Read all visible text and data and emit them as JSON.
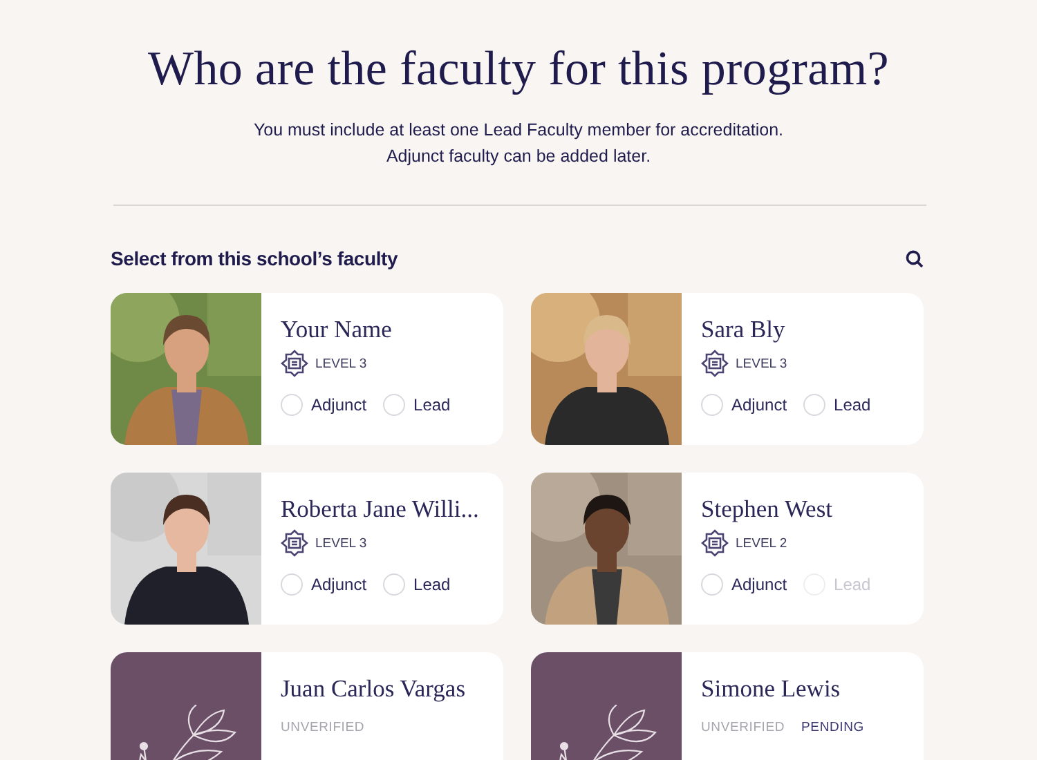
{
  "header": {
    "title": "Who are the faculty for this program?",
    "subtitle_lines": [
      "You must include at least one Lead Faculty member for accreditation.",
      "Adjunct faculty can be added later."
    ]
  },
  "section": {
    "title": "Select from this school’s faculty"
  },
  "faculty": [
    {
      "name": "Your Name",
      "level": "LEVEL 3",
      "options": [
        {
          "label": "Adjunct",
          "selected": false,
          "disabled": false
        },
        {
          "label": "Lead",
          "selected": false,
          "disabled": false
        }
      ]
    },
    {
      "name": "Sara Bly",
      "level": "LEVEL 3",
      "options": [
        {
          "label": "Adjunct",
          "selected": false,
          "disabled": false
        },
        {
          "label": "Lead",
          "selected": false,
          "disabled": false
        }
      ]
    },
    {
      "name": "Roberta Jane Willi...",
      "level": "LEVEL 3",
      "options": [
        {
          "label": "Adjunct",
          "selected": false,
          "disabled": false
        },
        {
          "label": "Lead",
          "selected": false,
          "disabled": false
        }
      ]
    },
    {
      "name": "Stephen West",
      "level": "LEVEL 2",
      "options": [
        {
          "label": "Adjunct",
          "selected": false,
          "disabled": false
        },
        {
          "label": "Lead",
          "selected": false,
          "disabled": true
        }
      ]
    },
    {
      "kind": "placeholder",
      "name": "Juan Carlos Vargas",
      "tags": [
        {
          "label": "UNVERIFIED",
          "kind": "muted"
        }
      ]
    },
    {
      "kind": "placeholder",
      "name": "Simone Lewis",
      "tags": [
        {
          "label": "UNVERIFIED",
          "kind": "muted"
        },
        {
          "label": "PENDING",
          "kind": "strong"
        }
      ]
    }
  ]
}
